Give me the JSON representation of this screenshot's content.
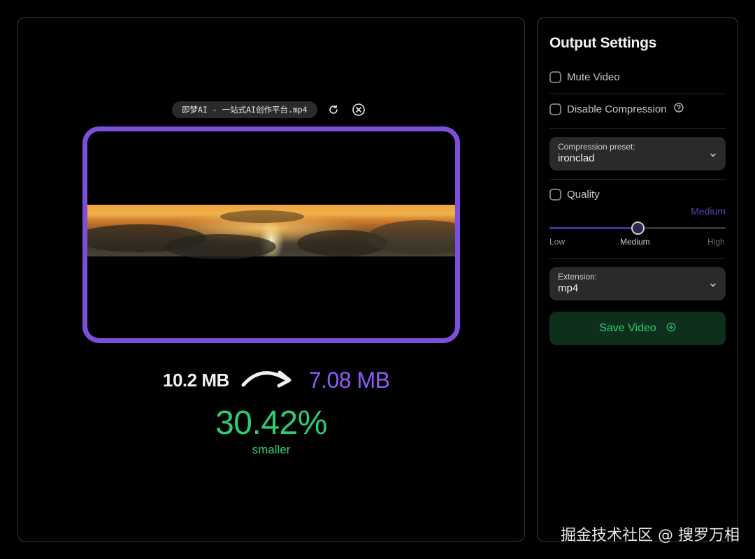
{
  "file": {
    "name": "即梦AI - 一站式AI创作平台.mp4"
  },
  "stats": {
    "original_size": "10.2 MB",
    "new_size": "7.08 MB",
    "percent": "30.42%",
    "percent_label": "smaller"
  },
  "settings": {
    "title": "Output Settings",
    "mute_label": "Mute Video",
    "disable_compression_label": "Disable Compression",
    "preset": {
      "label": "Compression preset:",
      "value": "ironclad"
    },
    "quality": {
      "label": "Quality",
      "value_label": "Medium",
      "level": 0.5,
      "ticks": [
        "Low",
        "Medium",
        "High"
      ]
    },
    "extension": {
      "label": "Extension:",
      "value": "mp4"
    },
    "save_label": "Save Video"
  },
  "colors": {
    "accent_purple": "#7c4fdb",
    "success_green": "#2ecc71",
    "panel_border": "#3a3a3a"
  },
  "watermark": "掘金技术社区 @ 搜罗万相"
}
